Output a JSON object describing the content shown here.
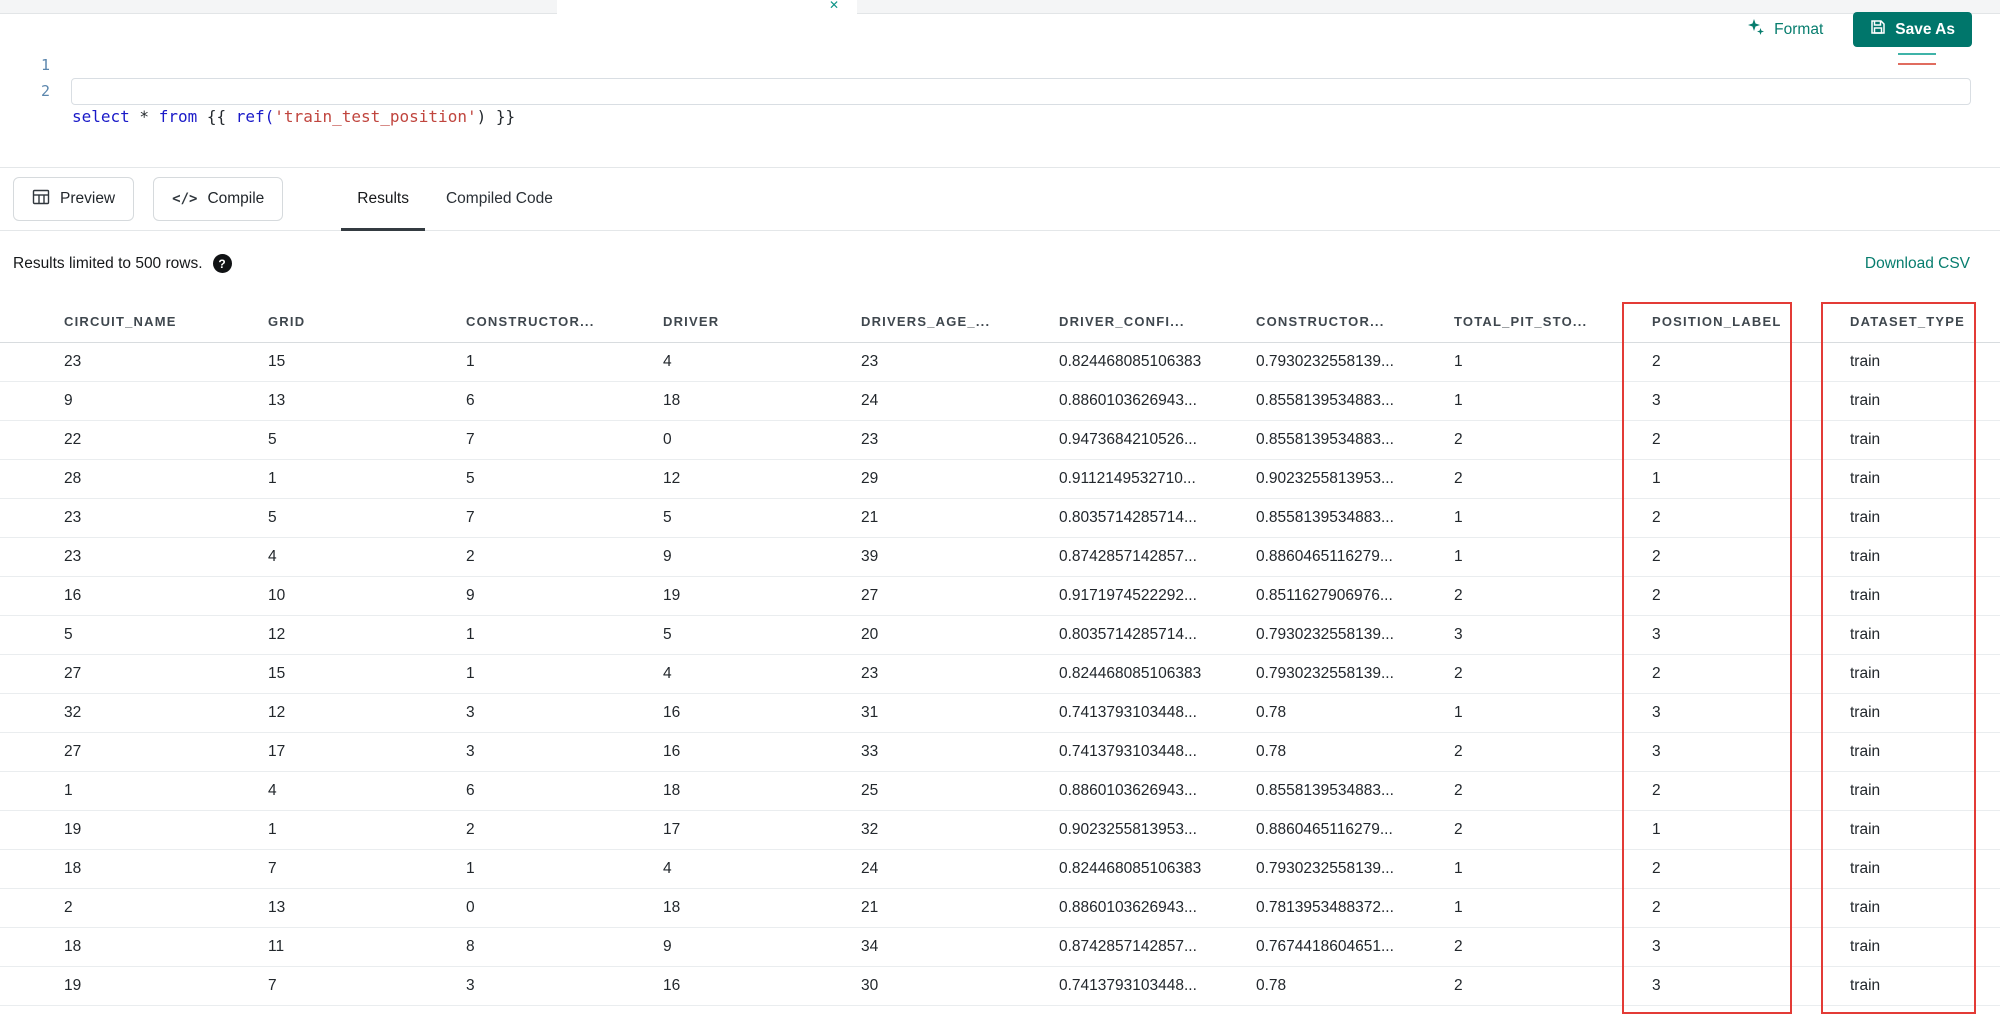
{
  "top_bar": {
    "tab_close_icon": "✕"
  },
  "editor": {
    "line_numbers": [
      "1",
      "2"
    ],
    "code_tokens": [
      "select",
      " * ",
      "from",
      " {{ ",
      "ref(",
      "'train_test_position'",
      ") }}"
    ]
  },
  "toolbar": {
    "format": "Format",
    "save_as": "Save As"
  },
  "actions": {
    "preview": "Preview",
    "compile": "Compile",
    "compile_icon": "</>"
  },
  "tabs": {
    "results": "Results",
    "compiled_code": "Compiled Code"
  },
  "results_bar": {
    "limit_text": "Results limited to 500 rows.",
    "help": "?",
    "download_csv": "Download CSV"
  },
  "table": {
    "columns": [
      "CIRCUIT_NAME",
      "GRID",
      "CONSTRUCTOR...",
      "DRIVER",
      "DRIVERS_AGE_...",
      "DRIVER_CONFI...",
      "CONSTRUCTOR...",
      "TOTAL_PIT_STO...",
      "POSITION_LABEL",
      "DATASET_TYPE"
    ],
    "rows": [
      [
        "23",
        "15",
        "1",
        "4",
        "23",
        "0.824468085106383",
        "0.7930232558139...",
        "1",
        "2",
        "train"
      ],
      [
        "9",
        "13",
        "6",
        "18",
        "24",
        "0.8860103626943...",
        "0.8558139534883...",
        "1",
        "3",
        "train"
      ],
      [
        "22",
        "5",
        "7",
        "0",
        "23",
        "0.9473684210526...",
        "0.8558139534883...",
        "2",
        "2",
        "train"
      ],
      [
        "28",
        "1",
        "5",
        "12",
        "29",
        "0.9112149532710...",
        "0.9023255813953...",
        "2",
        "1",
        "train"
      ],
      [
        "23",
        "5",
        "7",
        "5",
        "21",
        "0.8035714285714...",
        "0.8558139534883...",
        "1",
        "2",
        "train"
      ],
      [
        "23",
        "4",
        "2",
        "9",
        "39",
        "0.8742857142857...",
        "0.8860465116279...",
        "1",
        "2",
        "train"
      ],
      [
        "16",
        "10",
        "9",
        "19",
        "27",
        "0.9171974522292...",
        "0.8511627906976...",
        "2",
        "2",
        "train"
      ],
      [
        "5",
        "12",
        "1",
        "5",
        "20",
        "0.8035714285714...",
        "0.7930232558139...",
        "3",
        "3",
        "train"
      ],
      [
        "27",
        "15",
        "1",
        "4",
        "23",
        "0.824468085106383",
        "0.7930232558139...",
        "2",
        "2",
        "train"
      ],
      [
        "32",
        "12",
        "3",
        "16",
        "31",
        "0.7413793103448...",
        "0.78",
        "1",
        "3",
        "train"
      ],
      [
        "27",
        "17",
        "3",
        "16",
        "33",
        "0.7413793103448...",
        "0.78",
        "2",
        "3",
        "train"
      ],
      [
        "1",
        "4",
        "6",
        "18",
        "25",
        "0.8860103626943...",
        "0.8558139534883...",
        "2",
        "2",
        "train"
      ],
      [
        "19",
        "1",
        "2",
        "17",
        "32",
        "0.9023255813953...",
        "0.8860465116279...",
        "2",
        "1",
        "train"
      ],
      [
        "18",
        "7",
        "1",
        "4",
        "24",
        "0.824468085106383",
        "0.7930232558139...",
        "1",
        "2",
        "train"
      ],
      [
        "2",
        "13",
        "0",
        "18",
        "21",
        "0.8860103626943...",
        "0.7813953488372...",
        "1",
        "2",
        "train"
      ],
      [
        "18",
        "11",
        "8",
        "9",
        "34",
        "0.8742857142857...",
        "0.7674418604651...",
        "2",
        "3",
        "train"
      ],
      [
        "19",
        "7",
        "3",
        "16",
        "30",
        "0.7413793103448...",
        "0.78",
        "2",
        "3",
        "train"
      ]
    ],
    "highlighted_columns": [
      "POSITION_LABEL",
      "DATASET_TYPE"
    ]
  },
  "colors": {
    "accent_teal": "#077d6e",
    "save_button_bg": "#00766b",
    "highlight_red": "#e33b36",
    "keyword_blue": "#1a1ac8",
    "string_red": "#c0453e"
  }
}
